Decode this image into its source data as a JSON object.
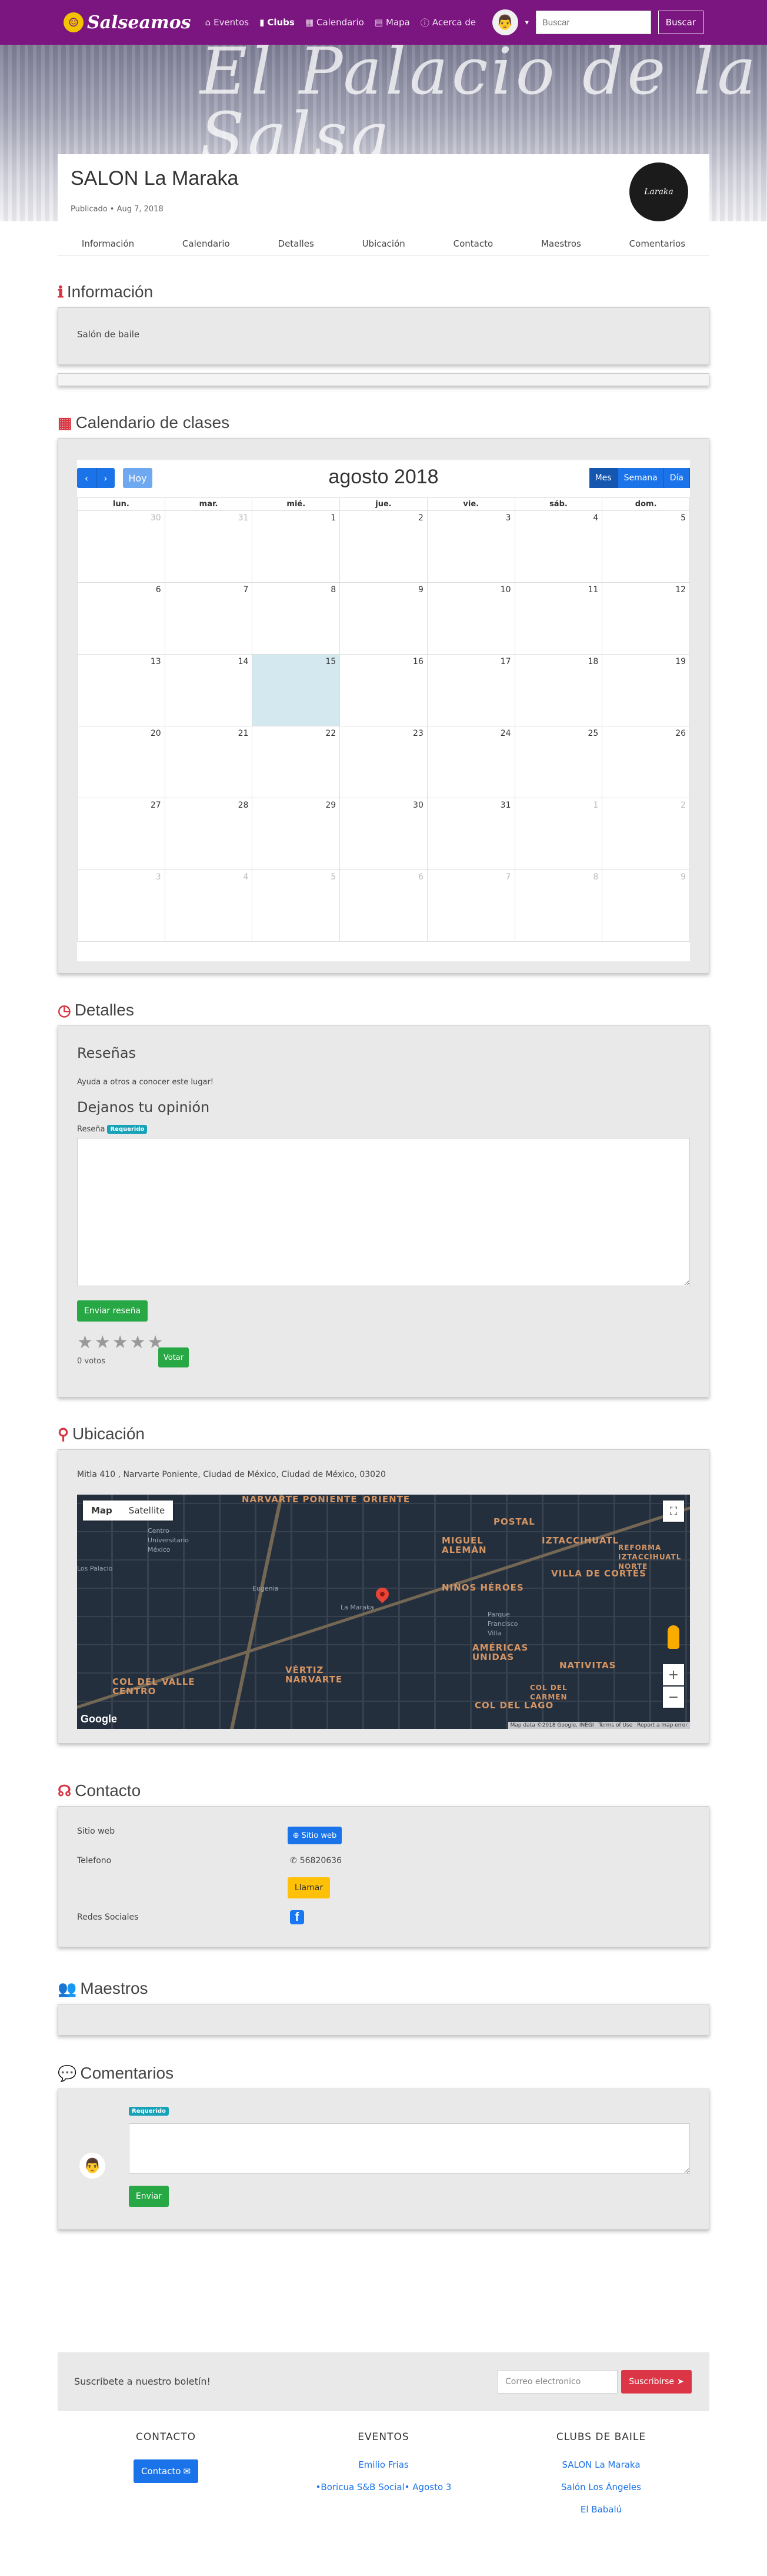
{
  "nav": {
    "brand": "Salseamos",
    "links": [
      {
        "icon": "home-icon",
        "glyph": "⌂",
        "label": "Eventos"
      },
      {
        "icon": "clubs-icon",
        "glyph": "▮",
        "label": "Clubs"
      },
      {
        "icon": "calendar-icon",
        "glyph": "▦",
        "label": "Calendario"
      },
      {
        "icon": "map-icon",
        "glyph": "▤",
        "label": "Mapa"
      },
      {
        "icon": "info-icon",
        "glyph": "ⓘ",
        "label": "Acerca de"
      }
    ],
    "search_placeholder": "Buscar",
    "search_button": "Buscar"
  },
  "hero": {
    "text": "El Palacio de la Salsa"
  },
  "club": {
    "title": "SALON La Maraka",
    "meta": "Publicado • Aug 7, 2018",
    "logo_text": "Laraka",
    "tabs": [
      "Información",
      "Calendario",
      "Detalles",
      "Ubicación",
      "Contacto",
      "Maestros",
      "Comentarios"
    ]
  },
  "info": {
    "title": "Información",
    "text": "Salón de baile"
  },
  "calendar": {
    "section_title": "Calendario de clases",
    "today_label": "Hoy",
    "month_title": "agosto 2018",
    "views": [
      "Mes",
      "Semana",
      "Día"
    ],
    "weekdays": [
      "lun.",
      "mar.",
      "mié.",
      "jue.",
      "vie.",
      "sáb.",
      "dom."
    ],
    "weeks": [
      [
        "30",
        "31",
        "1",
        "2",
        "3",
        "4",
        "5"
      ],
      [
        "6",
        "7",
        "8",
        "9",
        "10",
        "11",
        "12"
      ],
      [
        "13",
        "14",
        "15",
        "16",
        "17",
        "18",
        "19"
      ],
      [
        "20",
        "21",
        "22",
        "23",
        "24",
        "25",
        "26"
      ],
      [
        "27",
        "28",
        "29",
        "30",
        "31",
        "1",
        "2"
      ],
      [
        "3",
        "4",
        "5",
        "6",
        "7",
        "8",
        "9"
      ]
    ],
    "today": "15"
  },
  "details": {
    "title": "Detalles",
    "reviews_heading": "Reseñas",
    "reviews_prompt": "Ayuda a otros a conocer este lugar!",
    "opinion_heading": "Dejanos tu opinión",
    "review_label": "Reseña",
    "required_badge": "Requerido",
    "submit": "Enviar reseña",
    "votes": "0 votos",
    "vote_button": "Votar"
  },
  "location": {
    "title": "Ubicación",
    "address": "Mitla 410 , Narvarte Poniente, Ciudad de México, Ciudad de México, 03020",
    "map_types": [
      "Map",
      "Satellite"
    ],
    "labels": [
      "NARVARTE PONIENTE",
      "ORIENTE",
      "POSTAL",
      "MIGUEL ALEMÁN",
      "IZTACCIHUATL",
      "REFORMA IZTACCIHUATL NORTE",
      "VILLA DE CORTÉS",
      "NIÑOS HÉROES",
      "AMÉRICAS UNIDAS",
      "NATIVITAS",
      "VÉRTIZ NARVARTE",
      "COL DEL VALLE CENTRO",
      "COL DEL CARMEN",
      "COL DEL LAGO",
      "La Maraka",
      "Eugenia",
      "Parque Francisco Villa",
      "Centro Universitario México",
      "Los Palacio"
    ],
    "attribution": [
      "Map data ©2018 Google, INEGI",
      "Terms of Use",
      "Report a map error"
    ],
    "google": "Google"
  },
  "contact": {
    "title": "Contacto",
    "website_label": "Sitio web",
    "website_button": "Sitio web",
    "phone_label": "Telefono",
    "phone": "56820636",
    "call_button": "Llamar",
    "social_label": "Redes Sociales"
  },
  "teachers": {
    "title": "Maestros"
  },
  "comments": {
    "title": "Comentarios",
    "required_badge": "Requerido",
    "send": "Enviar"
  },
  "newsletter": {
    "label": "Suscribete a nuestro boletín!",
    "placeholder": "Correo electronico",
    "button": "Suscribirse"
  },
  "footer": {
    "contact": {
      "heading": "CONTACTO",
      "button": "Contacto"
    },
    "events": {
      "heading": "EVENTOS",
      "links": [
        "Emilio Frias",
        "•Boricua S&B Social• Agosto 3"
      ]
    },
    "clubs": {
      "heading": "CLUBS DE BAILE",
      "links": [
        "SALON La Maraka",
        "Salón Los Ángeles",
        "El Babalú"
      ]
    }
  },
  "colors": {
    "nav": "#7b157f",
    "accent_red": "#d9333f",
    "primary": "#1a73e8",
    "success": "#28a745",
    "warning": "#ffc107",
    "danger": "#dc3545"
  }
}
